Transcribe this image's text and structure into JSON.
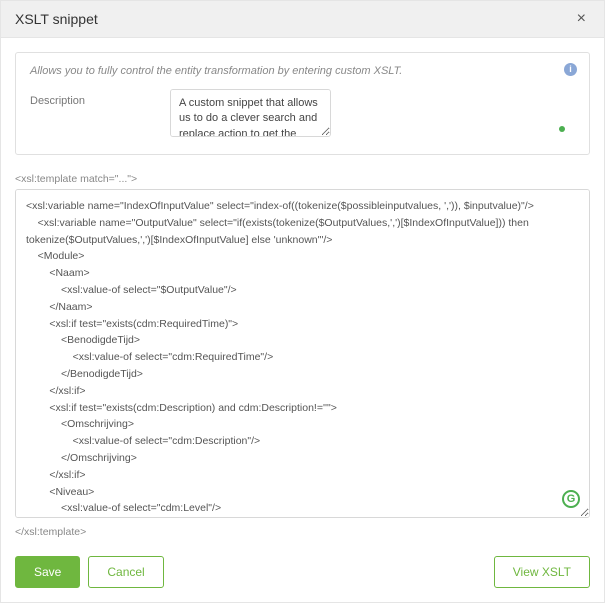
{
  "header": {
    "title": "XSLT snippet",
    "close_label": "×"
  },
  "info": {
    "hint": "Allows you to fully control the entity transformation by entering custom XSLT.",
    "icon_glyph": "i",
    "description_label": "Description",
    "description_value": "A custom snippet that allows us to do a clever search and replace action to get the proper name in the Naam element"
  },
  "template": {
    "open_tag": "<xsl:template match=\"...\">",
    "close_tag": "</xsl:template>",
    "code": "<xsl:variable name=\"IndexOfInputValue\" select=\"index-of((tokenize($possibleinputvalues, ',')), $inputvalue)\"/>\n    <xsl:variable name=\"OutputValue\" select=\"if(exists(tokenize($OutputValues,',')[$IndexOfInputValue])) then\ntokenize($OutputValues,',')[$IndexOfInputValue] else 'unknown'\"/>\n    <Module>\n        <Naam>\n            <xsl:value-of select=\"$OutputValue\"/>\n        </Naam>\n        <xsl:if test=\"exists(cdm:RequiredTime)\">\n            <BenodigdeTijd>\n                <xsl:value-of select=\"cdm:RequiredTime\"/>\n            </BenodigdeTijd>\n        </xsl:if>\n        <xsl:if test=\"exists(cdm:Description) and cdm:Description!=''\">\n            <Omschrijving>\n                <xsl:value-of select=\"cdm:Description\"/>\n            </Omschrijving>\n        </xsl:if>\n        <Niveau>\n            <xsl:value-of select=\"cdm:Level\"/>\n        </Niveau>\n    </Module>"
  },
  "footer": {
    "save_label": "Save",
    "cancel_label": "Cancel",
    "view_label": "View XSLT"
  },
  "badge": {
    "glyph": "G"
  }
}
